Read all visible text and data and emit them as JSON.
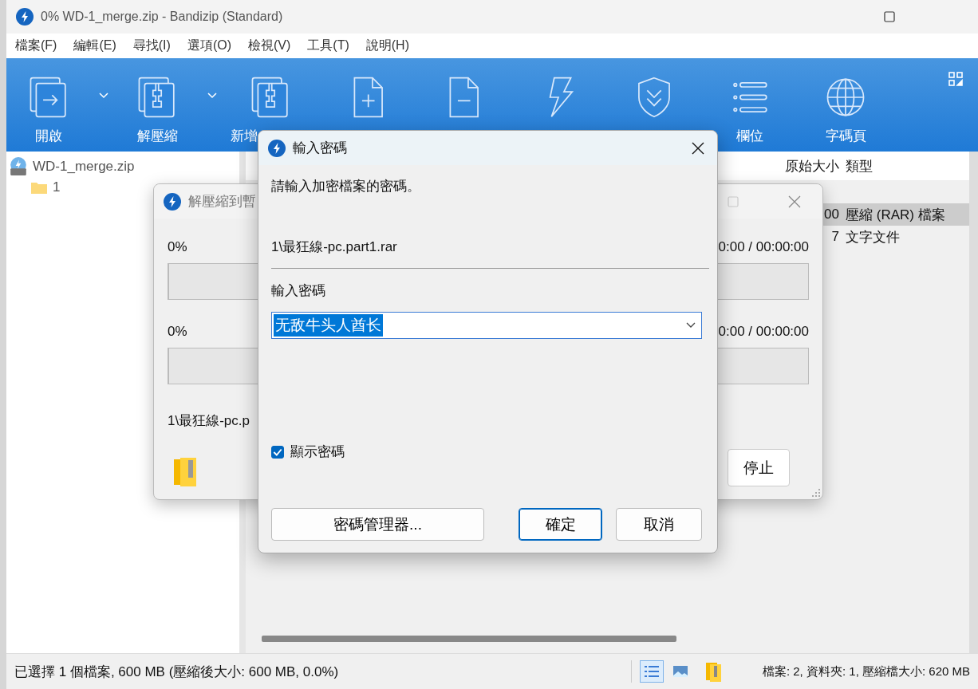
{
  "window": {
    "title": "0% WD-1_merge.zip - Bandizip (Standard)"
  },
  "menu": [
    "檔案(F)",
    "編輯(E)",
    "尋找(I)",
    "選項(O)",
    "檢視(V)",
    "工具(T)",
    "說明(H)"
  ],
  "toolbar": [
    {
      "kind": "open",
      "label": "開啟",
      "dropdown": true
    },
    {
      "kind": "extract",
      "label": "解壓縮",
      "dropdown": true
    },
    {
      "kind": "new",
      "label": "新增",
      "dropdown": false
    },
    {
      "kind": "add",
      "dropdown": false
    },
    {
      "kind": "delete",
      "dropdown": false
    },
    {
      "kind": "test",
      "dropdown": false
    },
    {
      "kind": "scan",
      "dropdown": false
    },
    {
      "kind": "columns",
      "label": "欄位",
      "dropdown": false
    },
    {
      "kind": "codepage",
      "label": "字碼頁",
      "dropdown": false
    }
  ],
  "tree": [
    {
      "kind": "archive",
      "label": "WD-1_merge.zip",
      "children": [
        {
          "kind": "folder",
          "label": "1"
        }
      ]
    }
  ],
  "file_list": {
    "columns": [
      "原始大小",
      "類型"
    ],
    "rows": [
      {
        "selected": false
      },
      {
        "size": "00",
        "type": "壓縮 (RAR) 檔案",
        "selected": true
      },
      {
        "size": "7",
        "type": "文字文件",
        "selected": false
      }
    ]
  },
  "status_bar": {
    "selection": "已選擇 1 個檔案, 600 MB (壓縮後大小: 600 MB, 0.0%)",
    "views": [
      {
        "kind": "details",
        "selected": true
      },
      {
        "kind": "thumbnails",
        "selected": false
      }
    ],
    "summary": "檔案: 2, 資料夾: 1, 壓縮檔大小: 620 MB"
  },
  "progress_dialog": {
    "title": "解壓縮到暫",
    "progress": [
      {
        "percent": "0%",
        "time": "0:00 / 00:00:00",
        "level": 0
      },
      {
        "percent": "0%",
        "time": "0:00 / 00:00:00",
        "level": 0
      }
    ],
    "current_file": "1\\最狂線-pc.p",
    "button": "停止"
  },
  "password_dialog": {
    "title": "輸入密碼",
    "prompt": "請輸入加密檔案的密碼。",
    "file": "1\\最狂線-pc.part1.rar",
    "field_label": "輸入密碼",
    "password": "无敌牛头人酋长",
    "show_password": true,
    "show_password_label": "顯示密碼",
    "buttons": [
      {
        "label": "密碼管理器...",
        "default": false
      },
      {
        "label": "確定",
        "default": true
      },
      {
        "label": "取消",
        "default": false
      }
    ]
  }
}
